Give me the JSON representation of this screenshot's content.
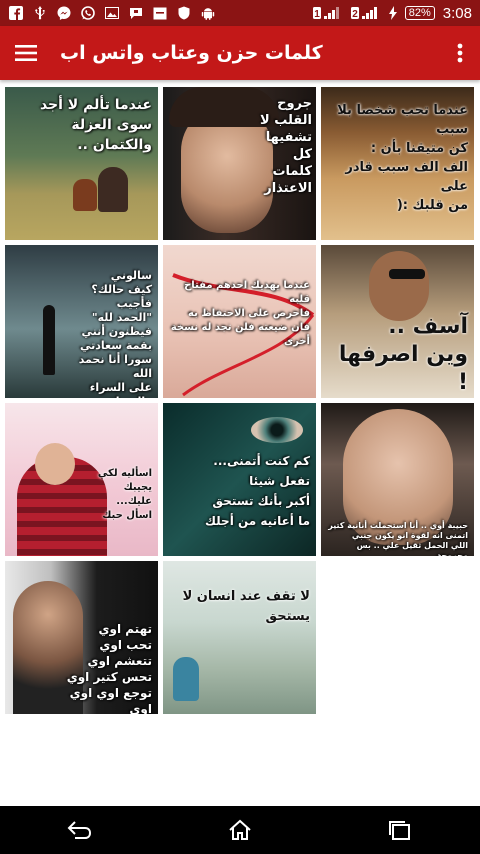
{
  "status_bar": {
    "battery": "82%",
    "time": "3:08",
    "sim1": "1",
    "sim2": "2",
    "left_icons": [
      "facebook-icon",
      "usb-icon",
      "messenger-icon",
      "whatsapp-icon",
      "image-icon",
      "chat-icon",
      "screenshot-icon",
      "shield-icon",
      "android-icon"
    ]
  },
  "app_bar": {
    "title": "كلمات حزن وعتاب واتس اب",
    "accent_color": "#c31818",
    "status_color": "#8b1414"
  },
  "tiles": [
    {
      "caption": "عندما تألم لا أجد\nسوى العزلة والكتمان ..",
      "style": "boys-sitting-autumn"
    },
    {
      "caption": "جروح\nالقلب لا\nتشفيها\nكل\nكلمات\nالاعتذار",
      "style": "girl-face-closeup"
    },
    {
      "caption": "عندما تحب شخصا بلا سبب\nكن متيقنا بأن :\nالف الف سبب قادر على\nمن قلبك :(",
      "style": "desert-sand"
    },
    {
      "caption": "سالوني\nكيف حالك؟ فأجيب\n\"الحمد لله\"\nفيظنون أنني بقمة سعادتي\nسورا أنا نحمد الله\nعلى السراء والضراء",
      "style": "man-in-fog"
    },
    {
      "caption": "عندما يهديك احدهم مفتاح قلبه\nفاحرص على الاحتفاظ به\nفان ضيعته فلن تجد له نسخة\nأخرى",
      "style": "hand-red-ribbon"
    },
    {
      "caption": "آسف ..\nوين اصرفها !",
      "style": "boy-sunglasses"
    },
    {
      "caption": "اسأليه لكي يجيبك\nعليك...\nاسأل حبك",
      "style": "heart-hands-boy"
    },
    {
      "caption": "كم كنت أتمنى...\nتفعل شيئا\nأكبر بأنك تستحق\nما أعانيه من أجلك",
      "style": "teal-eye"
    },
    {
      "caption": "حبيبة أوي .. أنا استحملت أنانية كتير\nاتمنى انه لقوة انو يكون جنبي\nاللي الحمل ثقيل علي .. بس مجروحة",
      "style": "crying-woman"
    },
    {
      "caption": "تهتم اوي\nتحب اوي\nتتعشم اوي\nتحس كتير اوي\nتوجع اوي اوي اوي",
      "style": "bearded-man"
    },
    {
      "caption": "لا تقف عند انسان لا يستحق",
      "style": "girl-on-road"
    }
  ],
  "nav_bar": {
    "buttons": [
      "back-icon",
      "home-icon",
      "recents-icon"
    ]
  }
}
